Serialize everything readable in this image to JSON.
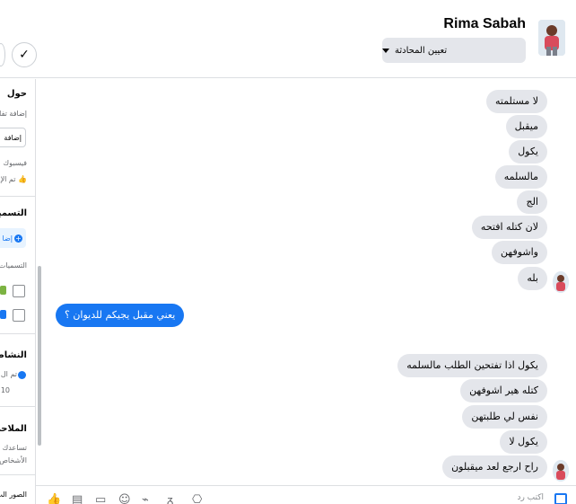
{
  "header": {
    "contact_name": "Rima Sabah",
    "assign_label": "تعيين المحادثة"
  },
  "sidebar": {
    "about_title": "حول",
    "about_sub": "إضافة تفا",
    "add_btn": "إضافة",
    "facebook_label": "فيسبوك",
    "liked_label": "تم الإ",
    "labels_title": "التسميا",
    "labels_add": "إضا",
    "labels_sub": "التسميات",
    "activity_title": "النشاط",
    "activity_item": "تم ال",
    "activity_time": "10",
    "notes_title": "الملاحظ",
    "notes_desc1": "تساعدك الم",
    "notes_desc2": "الأشخاص",
    "images_title": "الصور الت"
  },
  "messages": [
    {
      "dir": "in",
      "text": "لا مستلمته"
    },
    {
      "dir": "in",
      "text": "ميقبل"
    },
    {
      "dir": "in",
      "text": "يكول"
    },
    {
      "dir": "in",
      "text": "مالسلمه"
    },
    {
      "dir": "in",
      "text": "الج"
    },
    {
      "dir": "in",
      "text": "لان كتله افتحه"
    },
    {
      "dir": "in",
      "text": "واشوفهن"
    },
    {
      "dir": "in",
      "text": "بله"
    },
    {
      "dir": "out",
      "text": "يعني مقبل يجيكم للديوان ؟"
    },
    {
      "dir": "in",
      "text": "يكول اذا تفتحين الطلب مالسلمه"
    },
    {
      "dir": "in",
      "text": "كتله هير اشوفهن"
    },
    {
      "dir": "in",
      "text": "نفس لي طلبتهن"
    },
    {
      "dir": "in",
      "text": "يكول لا"
    },
    {
      "dir": "in",
      "text": "راح ارجع لعد ميقبلون"
    }
  ],
  "composer": {
    "placeholder": "اكتب رد",
    "icons": [
      "like-icon",
      "template-icon",
      "saved-reply-icon",
      "emoji-icon",
      "attach-icon",
      "gif-icon",
      "camera-icon"
    ]
  },
  "colors": {
    "accent": "#1877f2",
    "incoming_bubble": "#e4e6eb",
    "label_green": "#7cb342",
    "label_blue": "#1877f2"
  }
}
